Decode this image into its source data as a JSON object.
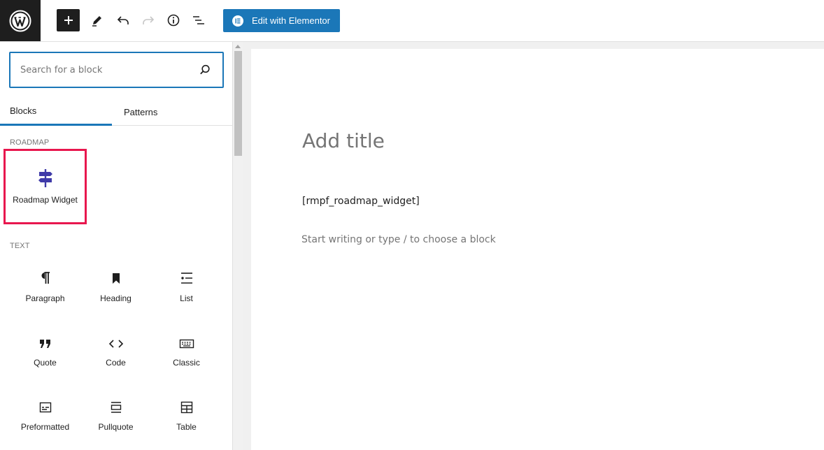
{
  "toolbar": {
    "elementor_label": "Edit with Elementor"
  },
  "inserter": {
    "search_placeholder": "Search for a block",
    "tabs": [
      {
        "label": "Blocks"
      },
      {
        "label": "Patterns"
      }
    ],
    "categories": {
      "roadmap": {
        "label": "ROADMAP",
        "items": [
          {
            "label": "Roadmap Widget",
            "icon": "signpost-icon"
          }
        ]
      },
      "text": {
        "label": "TEXT",
        "items": [
          {
            "label": "Paragraph",
            "icon": "paragraph-icon"
          },
          {
            "label": "Heading",
            "icon": "bookmark-icon"
          },
          {
            "label": "List",
            "icon": "list-icon"
          },
          {
            "label": "Quote",
            "icon": "quote-icon"
          },
          {
            "label": "Code",
            "icon": "code-icon"
          },
          {
            "label": "Classic",
            "icon": "keyboard-icon"
          },
          {
            "label": "Preformatted",
            "icon": "preformatted-icon"
          },
          {
            "label": "Pullquote",
            "icon": "pullquote-icon"
          },
          {
            "label": "Table",
            "icon": "table-icon"
          }
        ]
      }
    }
  },
  "editor": {
    "title_placeholder": "Add title",
    "shortcode_text": "[rmpf_roadmap_widget]",
    "block_placeholder": "Start writing or type / to choose a block"
  },
  "colors": {
    "accent": "#1b77b8",
    "highlight": "#e8174e",
    "roadmap_icon": "#3f3aa8"
  }
}
